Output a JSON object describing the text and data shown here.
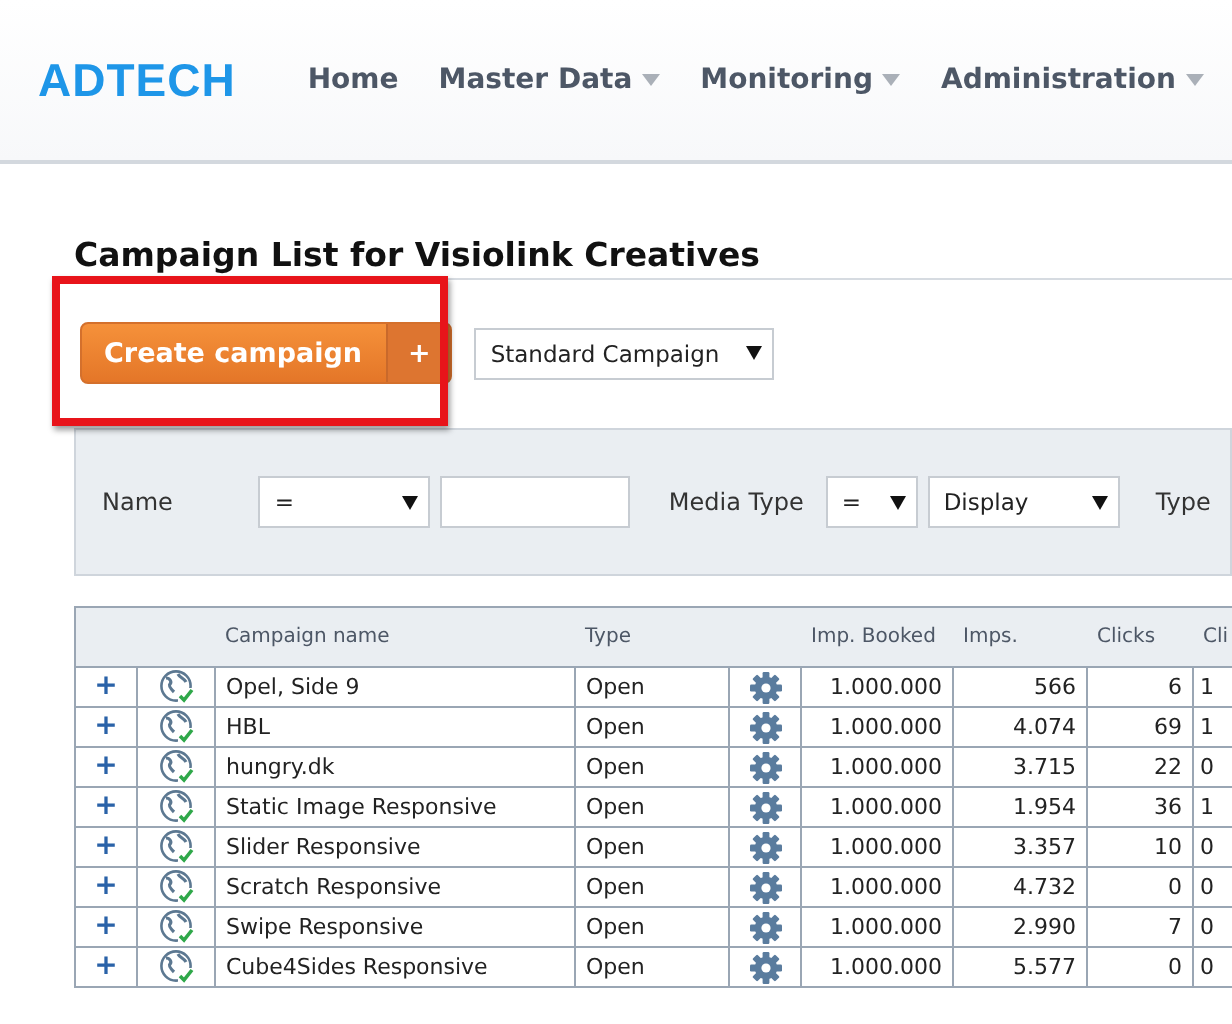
{
  "brand": "ADTECH",
  "nav": [
    {
      "label": "Home",
      "dropdown": false
    },
    {
      "label": "Master Data",
      "dropdown": true
    },
    {
      "label": "Monitoring",
      "dropdown": true
    },
    {
      "label": "Administration",
      "dropdown": true
    }
  ],
  "title": "Campaign List for Visiolink Creatives",
  "create_button": {
    "label": "Create campaign",
    "addon": "+"
  },
  "campaign_type_select": {
    "value": "Standard Campaign"
  },
  "filters": {
    "name_label": "Name",
    "name_operator": "=",
    "media_type_label": "Media Type",
    "media_type_operator": "=",
    "media_type_value": "Display",
    "type_label": "Type"
  },
  "table": {
    "columns": [
      "",
      "",
      "Campaign name",
      "Type",
      "",
      "Imp. Booked",
      "Imps.",
      "Clicks",
      "Cli"
    ],
    "rows": [
      {
        "expand": "+",
        "name": "Opel, Side 9",
        "type": "Open",
        "booked": "1.000.000",
        "imps": "566",
        "clicks": "6",
        "column_9": "1"
      },
      {
        "expand": "+",
        "name": "HBL",
        "type": "Open",
        "booked": "1.000.000",
        "imps": "4.074",
        "clicks": "69",
        "column_9": "1"
      },
      {
        "expand": "+",
        "name": "hungry.dk",
        "type": "Open",
        "booked": "1.000.000",
        "imps": "3.715",
        "clicks": "22",
        "column_9": "0"
      },
      {
        "expand": "+",
        "name": "Static Image Responsive",
        "type": "Open",
        "booked": "1.000.000",
        "imps": "1.954",
        "clicks": "36",
        "column_9": "1"
      },
      {
        "expand": "+",
        "name": "Slider Responsive",
        "type": "Open",
        "booked": "1.000.000",
        "imps": "3.357",
        "clicks": "10",
        "column_9": "0"
      },
      {
        "expand": "+",
        "name": "Scratch Responsive",
        "type": "Open",
        "booked": "1.000.000",
        "imps": "4.732",
        "clicks": "0",
        "column_9": "0"
      },
      {
        "expand": "+",
        "name": "Swipe Responsive",
        "type": "Open",
        "booked": "1.000.000",
        "imps": "2.990",
        "clicks": "7",
        "column_9": "0"
      },
      {
        "expand": "+",
        "name": "Cube4Sides Responsive",
        "type": "Open",
        "booked": "1.000.000",
        "imps": "5.577",
        "clicks": "0",
        "column_9": "0"
      }
    ]
  }
}
